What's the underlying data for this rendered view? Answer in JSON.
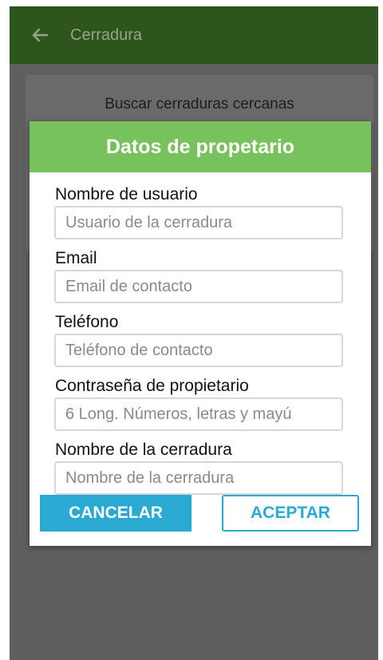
{
  "app": {
    "title": "Cerradura",
    "back_icon": "back-arrow-icon",
    "colors": {
      "appbar": "#2e561c",
      "overlay": "#5f5f5f",
      "dialog_header": "#77c25c",
      "accent": "#2aaad3"
    }
  },
  "background_card": {
    "text": "Buscar cerraduras cercanas"
  },
  "dialog": {
    "title": "Datos de propetario",
    "fields": [
      {
        "label": "Nombre de usuario",
        "placeholder": "Usuario de la cerradura"
      },
      {
        "label": "Email",
        "placeholder": "Email de contacto"
      },
      {
        "label": "Teléfono",
        "placeholder": "Teléfono de contacto"
      },
      {
        "label": "Contraseña de propietario",
        "placeholder": "6 Long. Números, letras y mayú"
      },
      {
        "label": "Nombre de la cerradura",
        "placeholder": "Nombre de la cerradura"
      }
    ],
    "cancel_label": "CANCELAR",
    "accept_label": "ACEPTAR"
  }
}
